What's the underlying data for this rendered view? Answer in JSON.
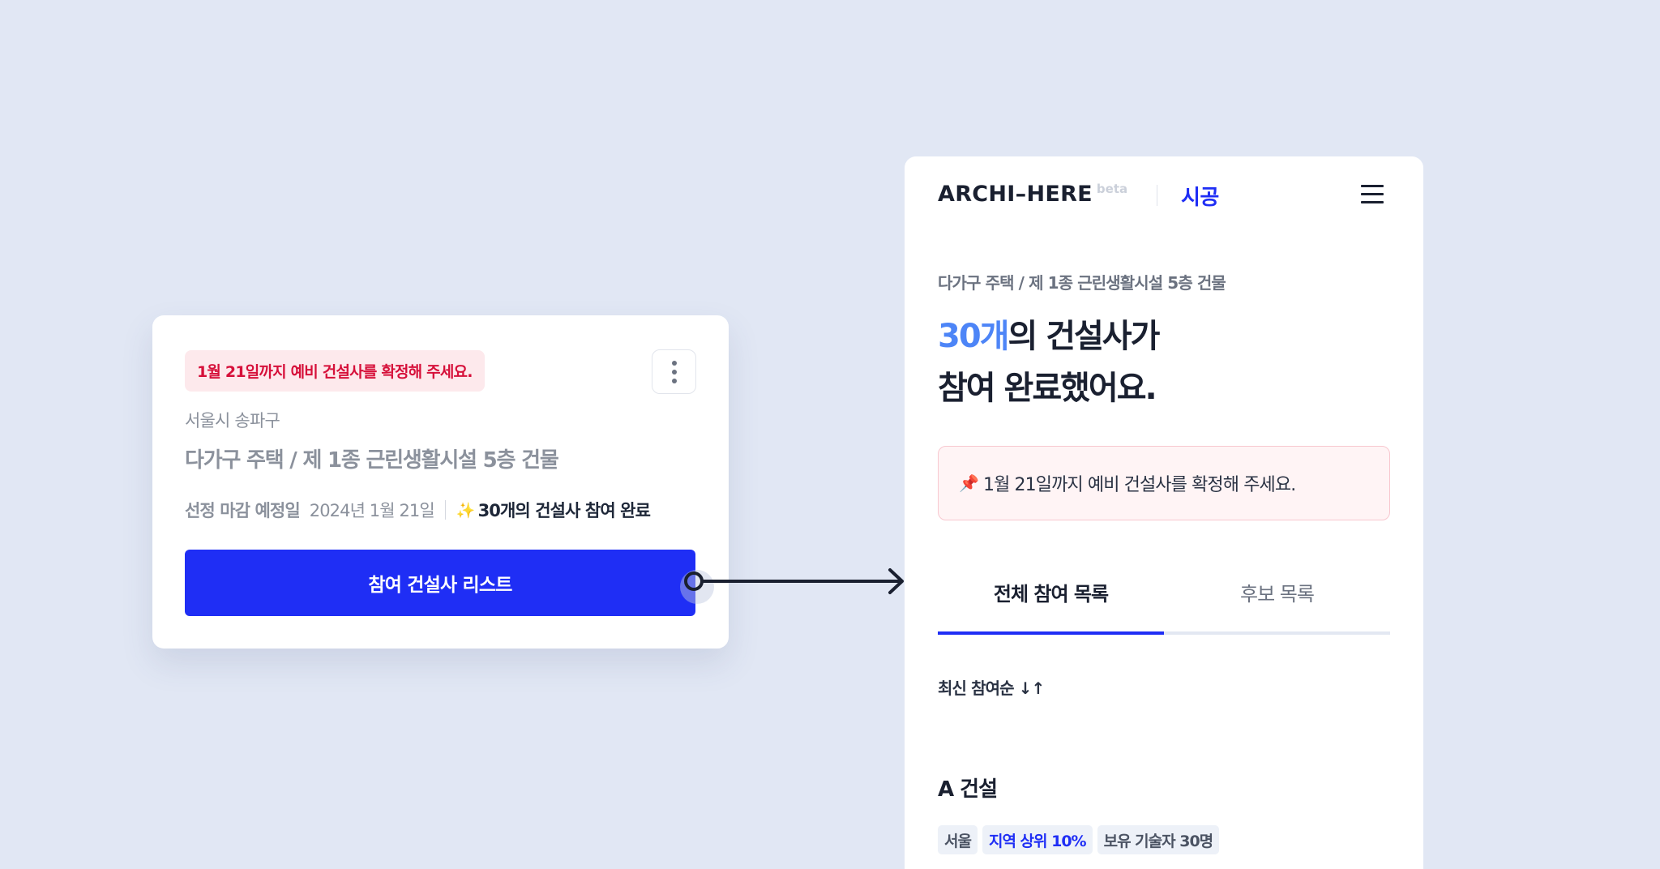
{
  "card": {
    "deadline_badge": "1월 21일까지 예비 건설사를 확정해 주세요.",
    "location": "서울시 송파구",
    "title": "다가구 주택 / 제 1종 근린생활시설 5층 건물",
    "deadline_label": "선정 마감 예정일",
    "deadline_date": "2024년 1월 21일",
    "sparkle": "✨",
    "participation": "30개의 건설사 참여 완료",
    "primary_button": "참여 건설사 리스트"
  },
  "panel": {
    "logo": "ARCHI–HERE",
    "logo_tag": "beta",
    "nav_label": "시공",
    "subtitle": "다가구 주택 / 제 1종 근린생활시설 5층 건물",
    "headline_count": "30개",
    "headline_rest": "의 건설사가",
    "headline_line2": "참여 완료했어요.",
    "notice_icon": "📌",
    "notice": "1월 21일까지 예비 건설사를 확정해 주세요.",
    "tabs": [
      {
        "label": "전체 참여 목록",
        "active": true
      },
      {
        "label": "후보 목록",
        "active": false
      }
    ],
    "sort_label": "최신 참여순 ↓↑",
    "company": {
      "name": "A 건설",
      "tags": [
        "서울",
        "지역 상위 10%",
        "보유 기술자 30명"
      ]
    }
  },
  "colors": {
    "background": "#e1e7f4",
    "primary": "#1f2ef5",
    "accent": "#4d85f7",
    "alert_text": "#d6103a",
    "alert_bg": "#fde9ec"
  }
}
